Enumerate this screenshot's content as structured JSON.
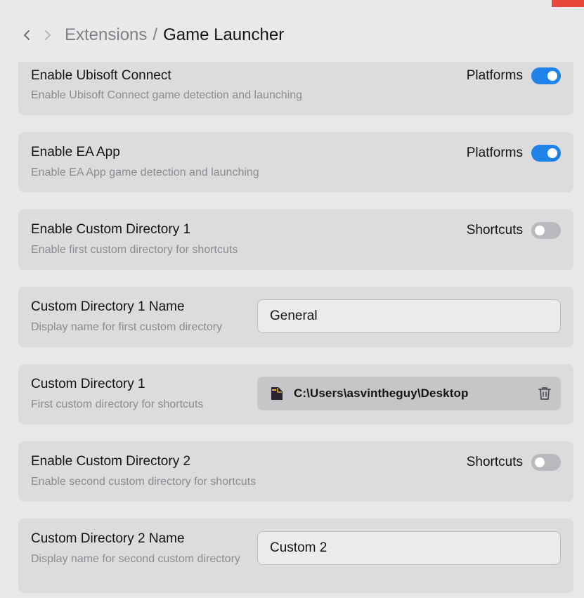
{
  "header": {
    "back_icon": "chevron-left-icon",
    "forward_icon": "chevron-right-icon",
    "breadcrumb_root": "Extensions",
    "breadcrumb_separator": "/",
    "breadcrumb_current": "Game Launcher"
  },
  "settings": [
    {
      "title": "Enable Ubisoft Connect",
      "description": "Enable Ubisoft Connect game detection and launching",
      "tag": "Platforms",
      "toggle_state": "on"
    },
    {
      "title": "Enable EA App",
      "description": "Enable EA App game detection and launching",
      "tag": "Platforms",
      "toggle_state": "on"
    },
    {
      "title": "Enable Custom Directory 1",
      "description": "Enable first custom directory for shortcuts",
      "tag": "Shortcuts",
      "toggle_state": "off"
    },
    {
      "title": "Custom Directory 1 Name",
      "description": "Display name for first custom directory",
      "input_value": "General"
    },
    {
      "title": "Custom Directory 1",
      "description": "First custom directory for shortcuts",
      "path": "C:\\Users\\asvintheguy\\Desktop",
      "path_icon": "file-icon",
      "remove_icon": "trash-icon"
    },
    {
      "title": "Enable Custom Directory 2",
      "description": "Enable second custom directory for shortcuts",
      "tag": "Shortcuts",
      "toggle_state": "off"
    },
    {
      "title": "Custom Directory 2 Name",
      "description": "Display name for second custom directory",
      "input_value": "Custom 2"
    }
  ],
  "colors": {
    "accent": "#1e82e8",
    "toggle_off": "#b9b9bd",
    "card_bg": "#dcdcde",
    "window_bg": "#e9e9eb",
    "close_red": "#e8473c"
  }
}
